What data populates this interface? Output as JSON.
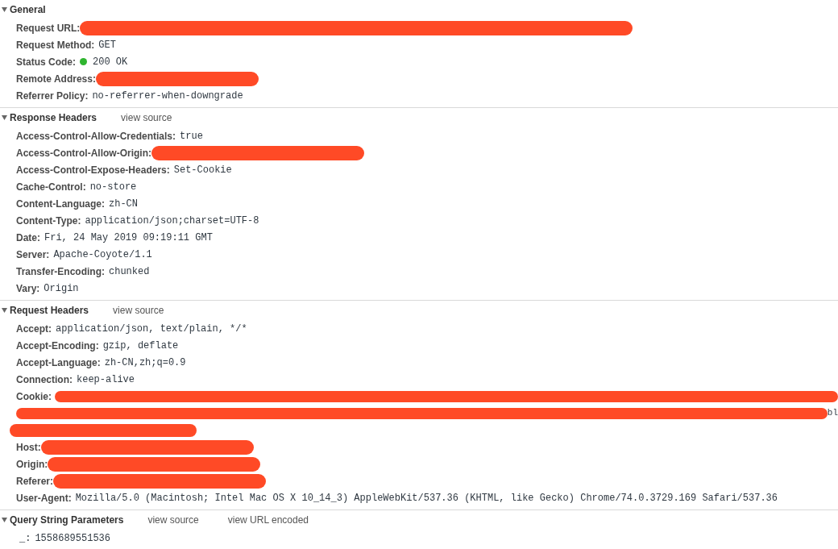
{
  "sections": [
    {
      "title": "General",
      "expanded": true,
      "rows": [
        {
          "kind": "header",
          "name": "Request URL:",
          "redacted": true
        },
        {
          "kind": "header",
          "name": "Request Method:",
          "value": "GET"
        },
        {
          "kind": "header",
          "name": "Status Code:",
          "value": "200 OK",
          "color": "#2fb52f"
        },
        {
          "kind": "header",
          "name": "Remote Address:",
          "redacted": true
        },
        {
          "kind": "header",
          "name": "Referrer Policy:",
          "value": "no-referrer-when-downgrade"
        }
      ]
    },
    {
      "title": "Response Headers",
      "expanded": true,
      "links": [
        "view source"
      ],
      "rows": [
        {
          "kind": "header",
          "name": "Access-Control-Allow-Credentials:",
          "value": "true"
        },
        {
          "kind": "header",
          "name": "Access-Control-Allow-Origin:",
          "redacted": true
        },
        {
          "kind": "header",
          "name": "Access-Control-Expose-Headers:",
          "value": "Set-Cookie"
        },
        {
          "kind": "header",
          "name": "Cache-Control:",
          "value": "no-store"
        },
        {
          "kind": "header",
          "name": "Content-Language:",
          "value": "zh-CN"
        },
        {
          "kind": "header",
          "name": "Content-Type:",
          "value": "application/json;charset=UTF-8"
        },
        {
          "kind": "header",
          "name": "Date:",
          "value": "Fri, 24 May 2019 09:19:11 GMT"
        },
        {
          "kind": "header",
          "name": "Server:",
          "value": "Apache-Coyote/1.1"
        },
        {
          "kind": "header",
          "name": "Transfer-Encoding:",
          "value": "chunked"
        },
        {
          "kind": "header",
          "name": "Vary:",
          "value": "Origin"
        }
      ]
    },
    {
      "title": "Request Headers",
      "expanded": true,
      "links": [
        "view source"
      ],
      "rows": [
        {
          "kind": "header",
          "name": "Accept:",
          "value": "application/json, text/plain, */*"
        },
        {
          "kind": "header",
          "name": "Accept-Encoding:",
          "value": "gzip, deflate"
        },
        {
          "kind": "header",
          "name": "Accept-Language:",
          "value": "zh-CN,zh;q=0.9"
        },
        {
          "kind": "header",
          "name": "Connection:",
          "value": "keep-alive"
        },
        {
          "kind": "wrapped",
          "name": "Cookie:",
          "redacted": true,
          "visible_tail": "bl"
        },
        {
          "kind": "header",
          "name": "Host:",
          "redacted": true
        },
        {
          "kind": "header",
          "name": "Origin:",
          "redacted": true
        },
        {
          "kind": "header",
          "name": "Referer:",
          "redacted": true
        },
        {
          "kind": "header",
          "name": "User-Agent:",
          "value": "Mozilla/5.0 (Macintosh; Intel Mac OS X 10_14_3) AppleWebKit/537.36 (KHTML, like Gecko) Chrome/74.0.3729.169 Safari/537.36"
        }
      ]
    },
    {
      "title": "Query String Parameters",
      "expanded": true,
      "links": [
        "view source",
        "view URL encoded"
      ],
      "rows": [
        {
          "kind": "param",
          "name": "_:",
          "value": "1558689551536"
        }
      ]
    }
  ]
}
